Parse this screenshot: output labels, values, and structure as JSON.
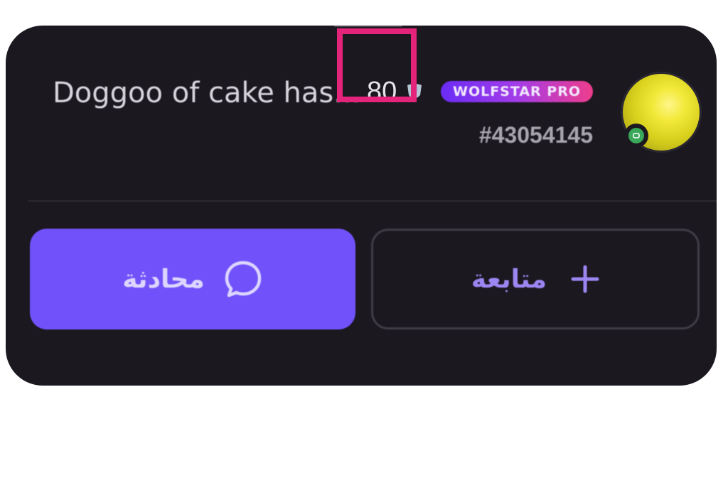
{
  "profile": {
    "username": "Doggoo of cake has...",
    "level": "80",
    "badge": "WOLFSTAR PRO",
    "user_id": "#43054145"
  },
  "actions": {
    "chat_label": "محادثة",
    "follow_label": "متابعة"
  },
  "icons": {
    "chat": "chat-bubble-icon",
    "follow": "plus-icon",
    "level": "level-shield-icon",
    "status": "online-status-icon"
  },
  "colors": {
    "card_background": "#1b1820",
    "primary_button": "#7152fa",
    "highlight_box": "#e4237b",
    "badge_gradient_start": "#6a2cf5",
    "badge_gradient_end": "#ee3d8c",
    "avatar": "#f2e93a",
    "status_green": "#3aa85a"
  }
}
